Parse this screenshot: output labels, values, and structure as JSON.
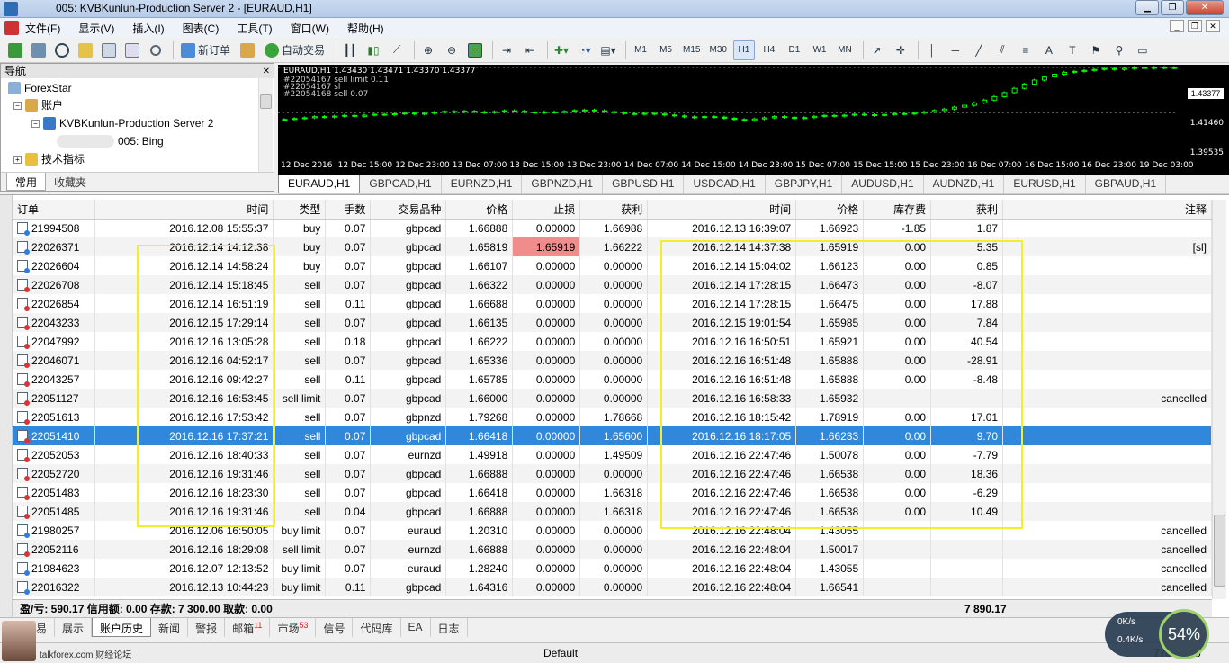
{
  "window": {
    "title": "005: KVBKunlun-Production Server 2 - [EURAUD,H1]"
  },
  "menu": [
    "文件(F)",
    "显示(V)",
    "插入(I)",
    "图表(C)",
    "工具(T)",
    "窗口(W)",
    "帮助(H)"
  ],
  "toolbar": {
    "new_order": "新订单",
    "auto_trade": "自动交易",
    "timeframes": [
      "M1",
      "M5",
      "M15",
      "M30",
      "H1",
      "H4",
      "D1",
      "W1",
      "MN"
    ],
    "active_timeframe": "H1"
  },
  "navigator": {
    "title": "导航",
    "items": [
      "ForexStar",
      "账户",
      "KVBKunlun-Production Server 2",
      "005: Bing",
      "技术指标"
    ],
    "tabs": [
      "常用",
      "收藏夹"
    ]
  },
  "chart": {
    "symbol_line": "EURAUD,H1 1.43430 1.43471 1.43370 1.43377",
    "order_lines": [
      "#22054167 sell limit 0.11",
      "#22054167 sl",
      "#22054168 sell 0.07"
    ],
    "prices": [
      "1.43377",
      "1.41460",
      "1.39535"
    ],
    "time_labels": [
      "12 Dec 2016",
      "12 Dec 15:00",
      "12 Dec 23:00",
      "13 Dec 07:00",
      "13 Dec 15:00",
      "13 Dec 23:00",
      "14 Dec 07:00",
      "14 Dec 15:00",
      "14 Dec 23:00",
      "15 Dec 07:00",
      "15 Dec 15:00",
      "15 Dec 23:00",
      "16 Dec 07:00",
      "16 Dec 15:00",
      "16 Dec 23:00",
      "19 Dec 03:00"
    ],
    "colors": {
      "background": "#000000",
      "candle": "#00ff00",
      "text": "#ffffff"
    },
    "closes": [
      1.4118,
      1.4122,
      1.4125,
      1.413,
      1.4128,
      1.4132,
      1.4135,
      1.4131,
      1.4136,
      1.414,
      1.4138,
      1.4142,
      1.4145,
      1.4141,
      1.4144,
      1.4148,
      1.4152,
      1.4149,
      1.4153,
      1.415,
      1.4147,
      1.4151,
      1.4155,
      1.4153,
      1.4149,
      1.4146,
      1.415,
      1.4148,
      1.4152,
      1.4156,
      1.4158,
      1.4155,
      1.4151,
      1.4147,
      1.4143,
      1.414,
      1.4144,
      1.4141,
      1.4137,
      1.4133,
      1.4129,
      1.4126,
      1.413,
      1.4128,
      1.4123,
      1.4118,
      1.4114,
      1.412,
      1.4125,
      1.413,
      1.4127,
      1.4122,
      1.4126,
      1.4131,
      1.4135,
      1.4132,
      1.4136,
      1.414,
      1.4138,
      1.4135,
      1.4139,
      1.4143,
      1.4141,
      1.4145,
      1.415,
      1.4156,
      1.4162,
      1.417,
      1.4178,
      1.4188,
      1.42,
      1.4215,
      1.4232,
      1.425,
      1.4268,
      1.4285,
      1.4298,
      1.431,
      1.4318,
      1.4322,
      1.4326,
      1.433,
      1.4334,
      1.433,
      1.4335,
      1.4338,
      1.4336,
      1.4339,
      1.4337,
      1.4338
    ]
  },
  "chart_tabs": [
    "EURAUD,H1",
    "GBPCAD,H1",
    "EURNZD,H1",
    "GBPNZD,H1",
    "GBPUSD,H1",
    "USDCAD,H1",
    "GBPJPY,H1",
    "AUDUSD,H1",
    "AUDNZD,H1",
    "EURUSD,H1",
    "GBPAUD,H1"
  ],
  "columns": [
    "订单",
    "时间",
    "类型",
    "手数",
    "交易品种",
    "价格",
    "止损",
    "获利",
    "时间",
    "价格",
    "库存费",
    "获利",
    "注释"
  ],
  "rows": [
    [
      "21994508",
      "2016.12.08 15:55:37",
      "buy",
      "0.07",
      "gbpcad",
      "1.66888",
      "0.00000",
      "1.66988",
      "2016.12.13 16:39:07",
      "1.66923",
      "-1.85",
      "1.87",
      ""
    ],
    [
      "22026371",
      "2016.12.14 14:12:38",
      "buy",
      "0.07",
      "gbpcad",
      "1.65819",
      "1.65919",
      "1.66222",
      "2016.12.14 14:37:38",
      "1.65919",
      "0.00",
      "5.35",
      "[sl]"
    ],
    [
      "22026604",
      "2016.12.14 14:58:24",
      "buy",
      "0.07",
      "gbpcad",
      "1.66107",
      "0.00000",
      "0.00000",
      "2016.12.14 15:04:02",
      "1.66123",
      "0.00",
      "0.85",
      ""
    ],
    [
      "22026708",
      "2016.12.14 15:18:45",
      "sell",
      "0.07",
      "gbpcad",
      "1.66322",
      "0.00000",
      "0.00000",
      "2016.12.14 17:28:15",
      "1.66473",
      "0.00",
      "-8.07",
      ""
    ],
    [
      "22026854",
      "2016.12.14 16:51:19",
      "sell",
      "0.11",
      "gbpcad",
      "1.66688",
      "0.00000",
      "0.00000",
      "2016.12.14 17:28:15",
      "1.66475",
      "0.00",
      "17.88",
      ""
    ],
    [
      "22043233",
      "2016.12.15 17:29:14",
      "sell",
      "0.07",
      "gbpcad",
      "1.66135",
      "0.00000",
      "0.00000",
      "2016.12.15 19:01:54",
      "1.65985",
      "0.00",
      "7.84",
      ""
    ],
    [
      "22047992",
      "2016.12.16 13:05:28",
      "sell",
      "0.18",
      "gbpcad",
      "1.66222",
      "0.00000",
      "0.00000",
      "2016.12.16 16:50:51",
      "1.65921",
      "0.00",
      "40.54",
      ""
    ],
    [
      "22046071",
      "2016.12.16 04:52:17",
      "sell",
      "0.07",
      "gbpcad",
      "1.65336",
      "0.00000",
      "0.00000",
      "2016.12.16 16:51:48",
      "1.65888",
      "0.00",
      "-28.91",
      ""
    ],
    [
      "22043257",
      "2016.12.16 09:42:27",
      "sell",
      "0.11",
      "gbpcad",
      "1.65785",
      "0.00000",
      "0.00000",
      "2016.12.16 16:51:48",
      "1.65888",
      "0.00",
      "-8.48",
      ""
    ],
    [
      "22051127",
      "2016.12.16 16:53:45",
      "sell limit",
      "0.07",
      "gbpcad",
      "1.66000",
      "0.00000",
      "0.00000",
      "2016.12.16 16:58:33",
      "1.65932",
      "",
      "",
      "cancelled"
    ],
    [
      "22051613",
      "2016.12.16 17:53:42",
      "sell",
      "0.07",
      "gbpnzd",
      "1.79268",
      "0.00000",
      "1.78668",
      "2016.12.16 18:15:42",
      "1.78919",
      "0.00",
      "17.01",
      ""
    ],
    [
      "22051410",
      "2016.12.16 17:37:21",
      "sell",
      "0.07",
      "gbpcad",
      "1.66418",
      "0.00000",
      "1.65600",
      "2016.12.16 18:17:05",
      "1.66233",
      "0.00",
      "9.70",
      ""
    ],
    [
      "22052053",
      "2016.12.16 18:40:33",
      "sell",
      "0.07",
      "eurnzd",
      "1.49918",
      "0.00000",
      "1.49509",
      "2016.12.16 22:47:46",
      "1.50078",
      "0.00",
      "-7.79",
      ""
    ],
    [
      "22052720",
      "2016.12.16 19:31:46",
      "sell",
      "0.07",
      "gbpcad",
      "1.66888",
      "0.00000",
      "0.00000",
      "2016.12.16 22:47:46",
      "1.66538",
      "0.00",
      "18.36",
      ""
    ],
    [
      "22051483",
      "2016.12.16 18:23:30",
      "sell",
      "0.07",
      "gbpcad",
      "1.66418",
      "0.00000",
      "1.66318",
      "2016.12.16 22:47:46",
      "1.66538",
      "0.00",
      "-6.29",
      ""
    ],
    [
      "22051485",
      "2016.12.16 19:31:46",
      "sell",
      "0.04",
      "gbpcad",
      "1.66888",
      "0.00000",
      "1.66318",
      "2016.12.16 22:47:46",
      "1.66538",
      "0.00",
      "10.49",
      ""
    ],
    [
      "21980257",
      "2016.12.06 16:50:05",
      "buy limit",
      "0.07",
      "euraud",
      "1.20310",
      "0.00000",
      "0.00000",
      "2016.12.16 22:48:04",
      "1.43055",
      "",
      "",
      "cancelled"
    ],
    [
      "22052116",
      "2016.12.16 18:29:08",
      "sell limit",
      "0.07",
      "eurnzd",
      "1.66888",
      "0.00000",
      "0.00000",
      "2016.12.16 22:48:04",
      "1.50017",
      "",
      "",
      "cancelled"
    ],
    [
      "21984623",
      "2016.12.07 12:13:52",
      "buy limit",
      "0.07",
      "euraud",
      "1.28240",
      "0.00000",
      "0.00000",
      "2016.12.16 22:48:04",
      "1.43055",
      "",
      "",
      "cancelled"
    ],
    [
      "22016322",
      "2016.12.13 10:44:23",
      "buy limit",
      "0.11",
      "gbpcad",
      "1.64316",
      "0.00000",
      "0.00000",
      "2016.12.16 22:48:04",
      "1.66541",
      "",
      "",
      "cancelled"
    ]
  ],
  "selected_row_index": 11,
  "sl_hit_row_index": 1,
  "summary": {
    "text": "盈/亏: 590.17  信用额: 0.00  存款: 7 300.00  取款: 0.00",
    "total": "7 890.17"
  },
  "bottom_tabs": [
    {
      "label": "交易",
      "badge": ""
    },
    {
      "label": "展示",
      "badge": ""
    },
    {
      "label": "账户历史",
      "badge": ""
    },
    {
      "label": "新闻",
      "badge": ""
    },
    {
      "label": "警报",
      "badge": ""
    },
    {
      "label": "邮箱",
      "badge": "11"
    },
    {
      "label": "市场",
      "badge": "53"
    },
    {
      "label": "信号",
      "badge": ""
    },
    {
      "label": "代码库",
      "badge": ""
    },
    {
      "label": "EA",
      "badge": ""
    },
    {
      "label": "日志",
      "badge": ""
    }
  ],
  "active_bottom_tab": "账户历史",
  "statusbar": {
    "watermark": "talkforex.com 财经论坛",
    "profile": "Default",
    "traffic": "7708/3 kb"
  },
  "net_widget": {
    "up": "0K/s",
    "down": "0.4K/s",
    "percent": "54%"
  },
  "highlight_color": "#f2ef2a"
}
